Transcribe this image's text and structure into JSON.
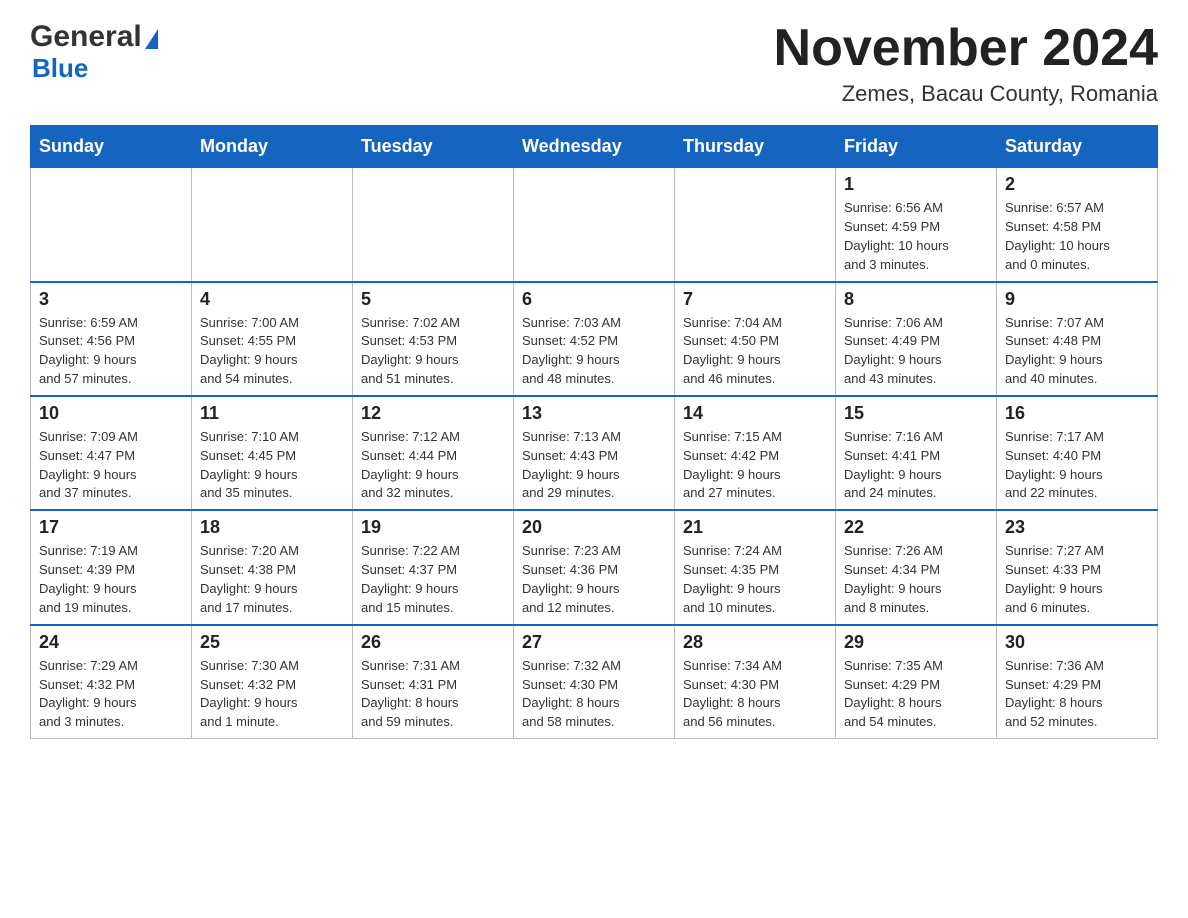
{
  "logo": {
    "line1": "General",
    "line2": "Blue"
  },
  "header": {
    "month": "November 2024",
    "location": "Zemes, Bacau County, Romania"
  },
  "days_of_week": [
    "Sunday",
    "Monday",
    "Tuesday",
    "Wednesday",
    "Thursday",
    "Friday",
    "Saturday"
  ],
  "weeks": [
    [
      {
        "day": "",
        "info": ""
      },
      {
        "day": "",
        "info": ""
      },
      {
        "day": "",
        "info": ""
      },
      {
        "day": "",
        "info": ""
      },
      {
        "day": "",
        "info": ""
      },
      {
        "day": "1",
        "info": "Sunrise: 6:56 AM\nSunset: 4:59 PM\nDaylight: 10 hours\nand 3 minutes."
      },
      {
        "day": "2",
        "info": "Sunrise: 6:57 AM\nSunset: 4:58 PM\nDaylight: 10 hours\nand 0 minutes."
      }
    ],
    [
      {
        "day": "3",
        "info": "Sunrise: 6:59 AM\nSunset: 4:56 PM\nDaylight: 9 hours\nand 57 minutes."
      },
      {
        "day": "4",
        "info": "Sunrise: 7:00 AM\nSunset: 4:55 PM\nDaylight: 9 hours\nand 54 minutes."
      },
      {
        "day": "5",
        "info": "Sunrise: 7:02 AM\nSunset: 4:53 PM\nDaylight: 9 hours\nand 51 minutes."
      },
      {
        "day": "6",
        "info": "Sunrise: 7:03 AM\nSunset: 4:52 PM\nDaylight: 9 hours\nand 48 minutes."
      },
      {
        "day": "7",
        "info": "Sunrise: 7:04 AM\nSunset: 4:50 PM\nDaylight: 9 hours\nand 46 minutes."
      },
      {
        "day": "8",
        "info": "Sunrise: 7:06 AM\nSunset: 4:49 PM\nDaylight: 9 hours\nand 43 minutes."
      },
      {
        "day": "9",
        "info": "Sunrise: 7:07 AM\nSunset: 4:48 PM\nDaylight: 9 hours\nand 40 minutes."
      }
    ],
    [
      {
        "day": "10",
        "info": "Sunrise: 7:09 AM\nSunset: 4:47 PM\nDaylight: 9 hours\nand 37 minutes."
      },
      {
        "day": "11",
        "info": "Sunrise: 7:10 AM\nSunset: 4:45 PM\nDaylight: 9 hours\nand 35 minutes."
      },
      {
        "day": "12",
        "info": "Sunrise: 7:12 AM\nSunset: 4:44 PM\nDaylight: 9 hours\nand 32 minutes."
      },
      {
        "day": "13",
        "info": "Sunrise: 7:13 AM\nSunset: 4:43 PM\nDaylight: 9 hours\nand 29 minutes."
      },
      {
        "day": "14",
        "info": "Sunrise: 7:15 AM\nSunset: 4:42 PM\nDaylight: 9 hours\nand 27 minutes."
      },
      {
        "day": "15",
        "info": "Sunrise: 7:16 AM\nSunset: 4:41 PM\nDaylight: 9 hours\nand 24 minutes."
      },
      {
        "day": "16",
        "info": "Sunrise: 7:17 AM\nSunset: 4:40 PM\nDaylight: 9 hours\nand 22 minutes."
      }
    ],
    [
      {
        "day": "17",
        "info": "Sunrise: 7:19 AM\nSunset: 4:39 PM\nDaylight: 9 hours\nand 19 minutes."
      },
      {
        "day": "18",
        "info": "Sunrise: 7:20 AM\nSunset: 4:38 PM\nDaylight: 9 hours\nand 17 minutes."
      },
      {
        "day": "19",
        "info": "Sunrise: 7:22 AM\nSunset: 4:37 PM\nDaylight: 9 hours\nand 15 minutes."
      },
      {
        "day": "20",
        "info": "Sunrise: 7:23 AM\nSunset: 4:36 PM\nDaylight: 9 hours\nand 12 minutes."
      },
      {
        "day": "21",
        "info": "Sunrise: 7:24 AM\nSunset: 4:35 PM\nDaylight: 9 hours\nand 10 minutes."
      },
      {
        "day": "22",
        "info": "Sunrise: 7:26 AM\nSunset: 4:34 PM\nDaylight: 9 hours\nand 8 minutes."
      },
      {
        "day": "23",
        "info": "Sunrise: 7:27 AM\nSunset: 4:33 PM\nDaylight: 9 hours\nand 6 minutes."
      }
    ],
    [
      {
        "day": "24",
        "info": "Sunrise: 7:29 AM\nSunset: 4:32 PM\nDaylight: 9 hours\nand 3 minutes."
      },
      {
        "day": "25",
        "info": "Sunrise: 7:30 AM\nSunset: 4:32 PM\nDaylight: 9 hours\nand 1 minute."
      },
      {
        "day": "26",
        "info": "Sunrise: 7:31 AM\nSunset: 4:31 PM\nDaylight: 8 hours\nand 59 minutes."
      },
      {
        "day": "27",
        "info": "Sunrise: 7:32 AM\nSunset: 4:30 PM\nDaylight: 8 hours\nand 58 minutes."
      },
      {
        "day": "28",
        "info": "Sunrise: 7:34 AM\nSunset: 4:30 PM\nDaylight: 8 hours\nand 56 minutes."
      },
      {
        "day": "29",
        "info": "Sunrise: 7:35 AM\nSunset: 4:29 PM\nDaylight: 8 hours\nand 54 minutes."
      },
      {
        "day": "30",
        "info": "Sunrise: 7:36 AM\nSunset: 4:29 PM\nDaylight: 8 hours\nand 52 minutes."
      }
    ]
  ]
}
